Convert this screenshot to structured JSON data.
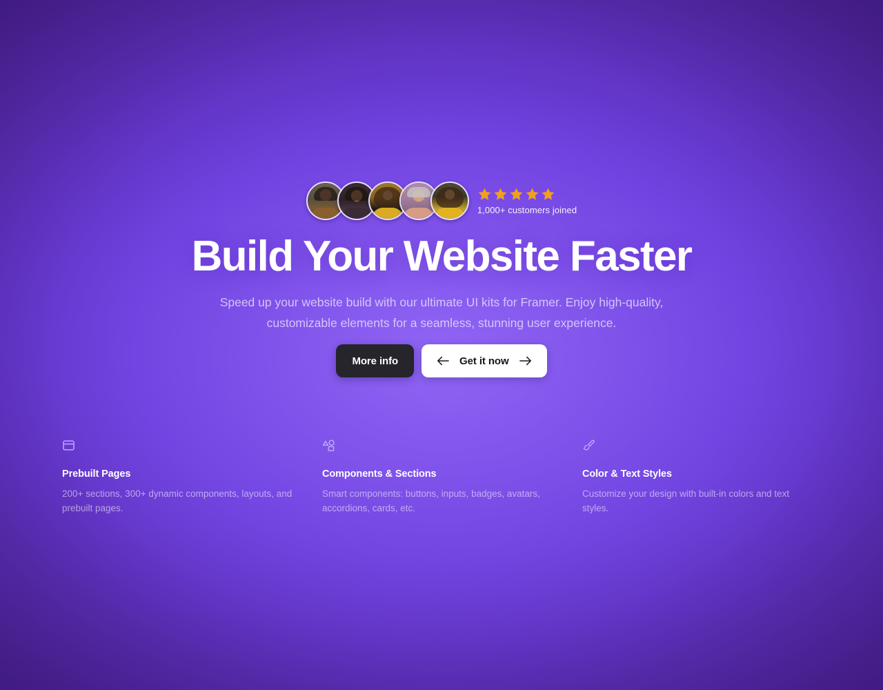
{
  "hero": {
    "social_proof": {
      "avatars": [
        {
          "name": "customer-avatar-1"
        },
        {
          "name": "customer-avatar-2"
        },
        {
          "name": "customer-avatar-3"
        },
        {
          "name": "customer-avatar-4"
        },
        {
          "name": "customer-avatar-5"
        }
      ],
      "star_count": 5,
      "star_color": "#f0a01e",
      "joined_label": "1,000+ customers joined"
    },
    "headline": "Build Your Website Faster",
    "subtitle": "Speed up your website build with our ultimate UI kits for Framer. Enjoy high-quality, customizable elements for a seamless, stunning user experience.",
    "buttons": [
      {
        "label": "More info",
        "style": "dark",
        "icon_left": "",
        "icon_right": ""
      },
      {
        "label": "Get it now",
        "style": "light",
        "icon_left": "arrow-left-icon",
        "icon_right": "arrow-right-icon"
      }
    ]
  },
  "features": [
    {
      "icon": "layout-panel-icon",
      "title": "Prebuilt Pages",
      "description": "200+ sections, 300+ dynamic components, layouts, and prebuilt pages."
    },
    {
      "icon": "shapes-icon",
      "title": "Components & Sections",
      "description": "Smart components: buttons, inputs, badges, avatars, accordions, cards, etc."
    },
    {
      "icon": "paintbrush-icon",
      "title": "Color & Text Styles",
      "description": "Customize your design with built-in colors and text styles."
    }
  ],
  "theme": {
    "background_center": "#7b4de8",
    "background_edge": "#3d1785",
    "dark_button_bg": "#25252b",
    "light_button_bg": "#ffffff",
    "text_primary": "#ffffff"
  }
}
